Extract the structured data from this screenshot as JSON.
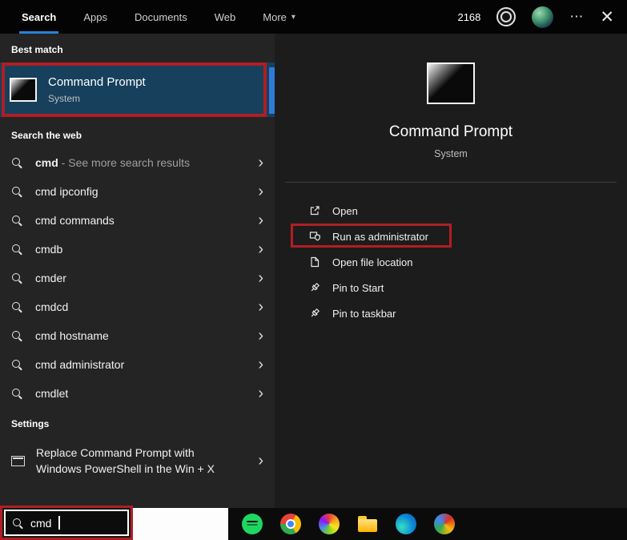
{
  "topbar": {
    "tabs": [
      {
        "label": "Search",
        "active": true
      },
      {
        "label": "Apps",
        "active": false
      },
      {
        "label": "Documents",
        "active": false
      },
      {
        "label": "Web",
        "active": false
      },
      {
        "label": "More",
        "active": false,
        "dropdown": true
      }
    ],
    "dropdown_arrow": "▾",
    "rewards_points": "2168",
    "ellipsis": "⋯",
    "close_glyph": "✕"
  },
  "left_panel": {
    "best_match_header": "Best match",
    "best_match": {
      "title": "Command Prompt",
      "subtitle": "System"
    },
    "web_header": "Search the web",
    "chevron": "›",
    "suggestions": [
      {
        "query": "cmd",
        "rest": " - See more search results",
        "muted_rest": true
      },
      {
        "query": "cmd",
        "rest": " ipconfig"
      },
      {
        "query": "cmd",
        "rest": " commands"
      },
      {
        "query": "cmd",
        "rest": "b"
      },
      {
        "query": "cmd",
        "rest": "er"
      },
      {
        "query": "cmd",
        "rest": "cd"
      },
      {
        "query": "cmd",
        "rest": " hostname"
      },
      {
        "query": "cmd",
        "rest": " administrator"
      },
      {
        "query": "cmd",
        "rest": "let"
      }
    ],
    "settings_header": "Settings",
    "settings_item": {
      "line1": "Replace Command Prompt with",
      "line2": "Windows PowerShell in the Win + X"
    }
  },
  "preview": {
    "title": "Command Prompt",
    "subtitle": "System",
    "actions": [
      {
        "label": "Open",
        "icon": "open-icon",
        "annotated": false
      },
      {
        "label": "Run as administrator",
        "icon": "admin-shield-icon",
        "annotated": true
      },
      {
        "label": "Open file location",
        "icon": "file-location-icon",
        "annotated": false
      },
      {
        "label": "Pin to Start",
        "icon": "pin-icon",
        "annotated": false
      },
      {
        "label": "Pin to taskbar",
        "icon": "pin-icon",
        "annotated": false
      }
    ]
  },
  "taskbar": {
    "search_value": "cmd",
    "icons": [
      {
        "name": "spotify-icon"
      },
      {
        "name": "chrome-icon"
      },
      {
        "name": "colorful-app-icon"
      },
      {
        "name": "file-explorer-icon"
      },
      {
        "name": "edge-icon"
      },
      {
        "name": "colorful-app-2-icon"
      }
    ]
  },
  "colors": {
    "accent_blue": "#2782d7",
    "annotation_red": "#b01e23",
    "best_match_highlight": "#16405c"
  }
}
